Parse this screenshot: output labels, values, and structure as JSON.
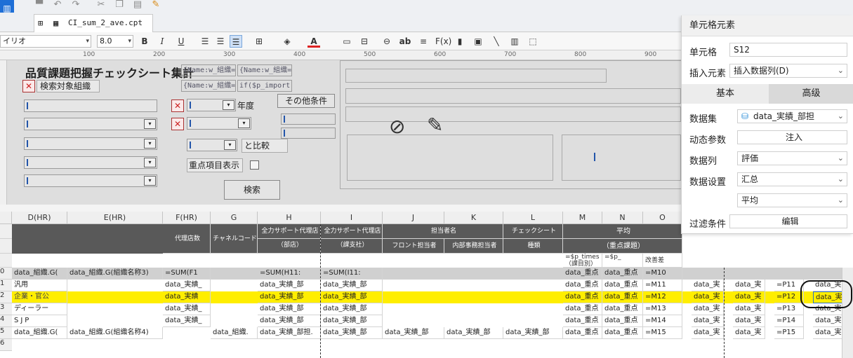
{
  "window": {
    "file_tab": "CI_sum_2_ave.cpt"
  },
  "format_bar": {
    "font": "イリオ",
    "size": "8.0",
    "bold": "B",
    "italic": "I",
    "underline": "U",
    "fx": "F(x)",
    "ab": "ab"
  },
  "ruler": {
    "ticks": [
      "100",
      "200",
      "300",
      "400",
      "500",
      "600",
      "700",
      "800",
      "900"
    ]
  },
  "design": {
    "title": "品質課題把握チェックシート集計",
    "search_org": "検索対象組織",
    "year_label": "年度",
    "other_conditions": "その他条件",
    "compare_label": "と比較",
    "key_items": "重点項目表示",
    "search_button": "検索",
    "formula1": "{Name:w_組織=",
    "formula2": "{Name:w_組織=",
    "formula3": "{Name:w_組織=",
    "formula4": "if($p_import"
  },
  "grid": {
    "columns": [
      "D(HR)",
      "E(HR)",
      "F(HR)",
      "G",
      "H",
      "I",
      "J",
      "K",
      "L",
      "M",
      "N",
      "O"
    ],
    "header": {
      "agency_count": "代理店数",
      "channel_code": "チャネルコード",
      "full_support_branch1": "全力サポート代理店",
      "full_support_branch2": "（部店）",
      "full_support_sub1": "全力サポート代理店",
      "full_support_sub2": "（課支社）",
      "person_in_charge": "担当者名",
      "front": "フロント担当者",
      "office": "内部事務担当者",
      "checksheet": "チェックシート",
      "kind": "種類",
      "average": "平均",
      "focus": "（重点課題）",
      "m5": "=$p_times",
      "m5b": "（課目別）",
      "n5": "=$p_",
      "o5": "改善差"
    },
    "row_numbers": [
      "",
      "",
      "",
      "0",
      "1",
      "2",
      "3",
      "4",
      "5",
      "6"
    ],
    "rows": [
      {
        "d": "data_組織.G(",
        "e": "data_組織.G(組織名称3)",
        "f": "=SUM(F1",
        "h": "=SUM(H11:",
        "i": "=SUM(I11:",
        "m": "data_重点",
        "n": "data_重点",
        "o": "=M10"
      },
      {
        "d": "汎用",
        "e": "",
        "f": "data_実績_",
        "h": "data_実績_部",
        "i": "data_実績_部",
        "m": "data_重点",
        "n": "data_重点",
        "o": "=M11",
        "p1": "data_実",
        "p2": "data_実",
        "p3": "=P11",
        "s": "data_実"
      },
      {
        "d": "企業・官公",
        "e": "",
        "f": "data_実績",
        "h": "data_実績_部",
        "i": "data_実績_部",
        "m": "data_重点",
        "n": "data_重点",
        "o": "=M12",
        "p1": "data_実",
        "p2": "data_実",
        "p3": "=P12",
        "s": "data_実"
      },
      {
        "d": "ディーラー",
        "e": "",
        "f": "data_実績_",
        "h": "data_実績_部",
        "i": "data_実績_部",
        "m": "data_重点",
        "n": "data_重点",
        "o": "=M13",
        "p1": "data_実",
        "p2": "data_実",
        "p3": "=P13",
        "s": "data_実"
      },
      {
        "d": "SJP",
        "e": "",
        "f": "data_実績_",
        "h": "data_実績_部",
        "i": "data_実績_部",
        "m": "data_重点",
        "n": "data_重点",
        "o": "=M14",
        "p1": "data_実",
        "p2": "data_実",
        "p3": "=P14",
        "s": "data_実"
      },
      {
        "d": "data_組織.G(",
        "e": "data_組織.G(組織名称4)",
        "f": "data_組織.",
        "h": "data_実績_部担.",
        "i": "data_実績_部",
        "j": "data_実績_部",
        "k": "data_実績_部",
        "l": "data_実績_部",
        "m": "data_重点",
        "n": "data_重点",
        "o": "=M15",
        "p1": "data_実",
        "p2": "data_実",
        "p3": "=P15",
        "s": "data_実"
      }
    ]
  },
  "panel": {
    "title": "单元格元素",
    "cell_label": "单元格",
    "cell_value": "S12",
    "insert_label": "插入元素",
    "insert_value": "插入数据列(D)",
    "tab_basic": "基本",
    "tab_advanced": "高级",
    "dataset_label": "数据集",
    "dataset_value": "data_実績_部担",
    "param_label": "动态参数",
    "param_value": "注入",
    "column_label": "数据列",
    "column_value": "評価",
    "setting_label": "数据设置",
    "setting_value": "汇总",
    "setting_sub": "平均",
    "filter_label": "过滤条件",
    "filter_value": "编辑"
  },
  "colors": {
    "highlight": "#ffee00",
    "accent": "#1f6fd6",
    "header_dark": "#595959"
  }
}
